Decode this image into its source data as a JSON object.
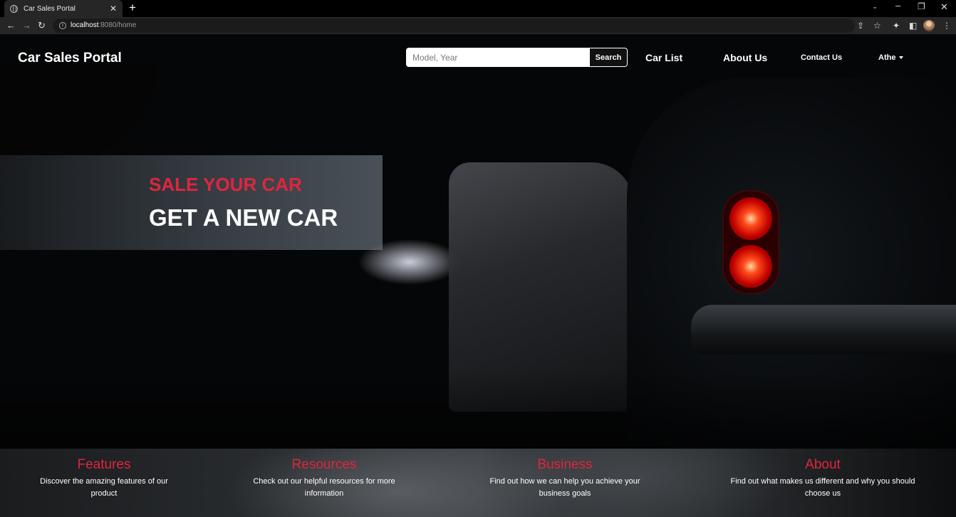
{
  "browser": {
    "tab_title": "Car Sales Portal",
    "new_tab_glyph": "+",
    "url_host": "localhost",
    "url_path": ":8080/home",
    "icons": [
      "globe-icon",
      "close-icon",
      "plus-icon",
      "back-icon",
      "forward-icon",
      "reload-icon",
      "info-icon",
      "share-icon",
      "star-icon",
      "extensions-icon",
      "side-panel-icon",
      "profile-avatar",
      "menu-icon"
    ]
  },
  "navbar": {
    "brand": "Car Sales Portal",
    "search_placeholder": "Model, Year",
    "search_button": "Search",
    "links": {
      "car_list": "Car List",
      "about_us": "About Us",
      "contact_us": "Contact Us",
      "user": "Athe"
    }
  },
  "hero": {
    "line1": "SALE YOUR CAR",
    "line2": "GET A NEW CAR"
  },
  "info": {
    "features": {
      "title": "Features",
      "text": "Discover the amazing features of our product"
    },
    "resources": {
      "title": "Resources",
      "text": "Check out our helpful resources for more information"
    },
    "business": {
      "title": "Business",
      "text": "Find out how we can help you achieve your business goals"
    },
    "about": {
      "title": "About",
      "text": "Find out what makes us different and why you should choose us"
    }
  },
  "colors": {
    "accent_red": "#e0253f",
    "nav_text": "#ffffff",
    "chrome_bg": "#262626"
  }
}
